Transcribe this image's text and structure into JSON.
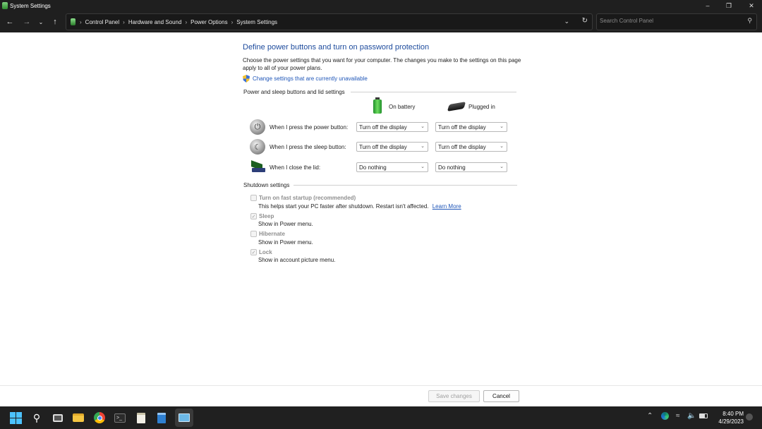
{
  "window": {
    "title": "System Settings"
  },
  "nav": {
    "breadcrumbs": [
      "Control Panel",
      "Hardware and Sound",
      "Power Options",
      "System Settings"
    ],
    "search_placeholder": "Search Control Panel"
  },
  "page": {
    "heading": "Define power buttons and turn on password protection",
    "description": "Choose the power settings that you want for your computer. The changes you make to the settings on this page apply to all of your power plans.",
    "change_link": "Change settings that are currently unavailable"
  },
  "power_section": {
    "title": "Power and sleep buttons and lid settings",
    "col_battery": "On battery",
    "col_plugged": "Plugged in",
    "rows": [
      {
        "label": "When I press the power button:",
        "battery": "Turn off the display",
        "plugged": "Turn off the display"
      },
      {
        "label": "When I press the sleep button:",
        "battery": "Turn off the display",
        "plugged": "Turn off the display"
      },
      {
        "label": "When I close the lid:",
        "battery": "Do nothing",
        "plugged": "Do nothing"
      }
    ]
  },
  "shutdown_section": {
    "title": "Shutdown settings",
    "items": [
      {
        "label": "Turn on fast startup (recommended)",
        "sub": "This helps start your PC faster after shutdown. Restart isn't affected.",
        "link": "Learn More",
        "checked": false
      },
      {
        "label": "Sleep",
        "sub": "Show in Power menu.",
        "checked": true
      },
      {
        "label": "Hibernate",
        "sub": "Show in Power menu.",
        "checked": false
      },
      {
        "label": "Lock",
        "sub": "Show in account picture menu.",
        "checked": true
      }
    ]
  },
  "buttons": {
    "save": "Save changes",
    "cancel": "Cancel"
  },
  "taskbar": {
    "time": "8:40 PM",
    "date": "4/29/2023"
  },
  "colors": {
    "accent_link": "#1f56b8",
    "heading": "#1c4a9c",
    "titlebar": "#1f1f1f",
    "taskbar": "#202020"
  }
}
